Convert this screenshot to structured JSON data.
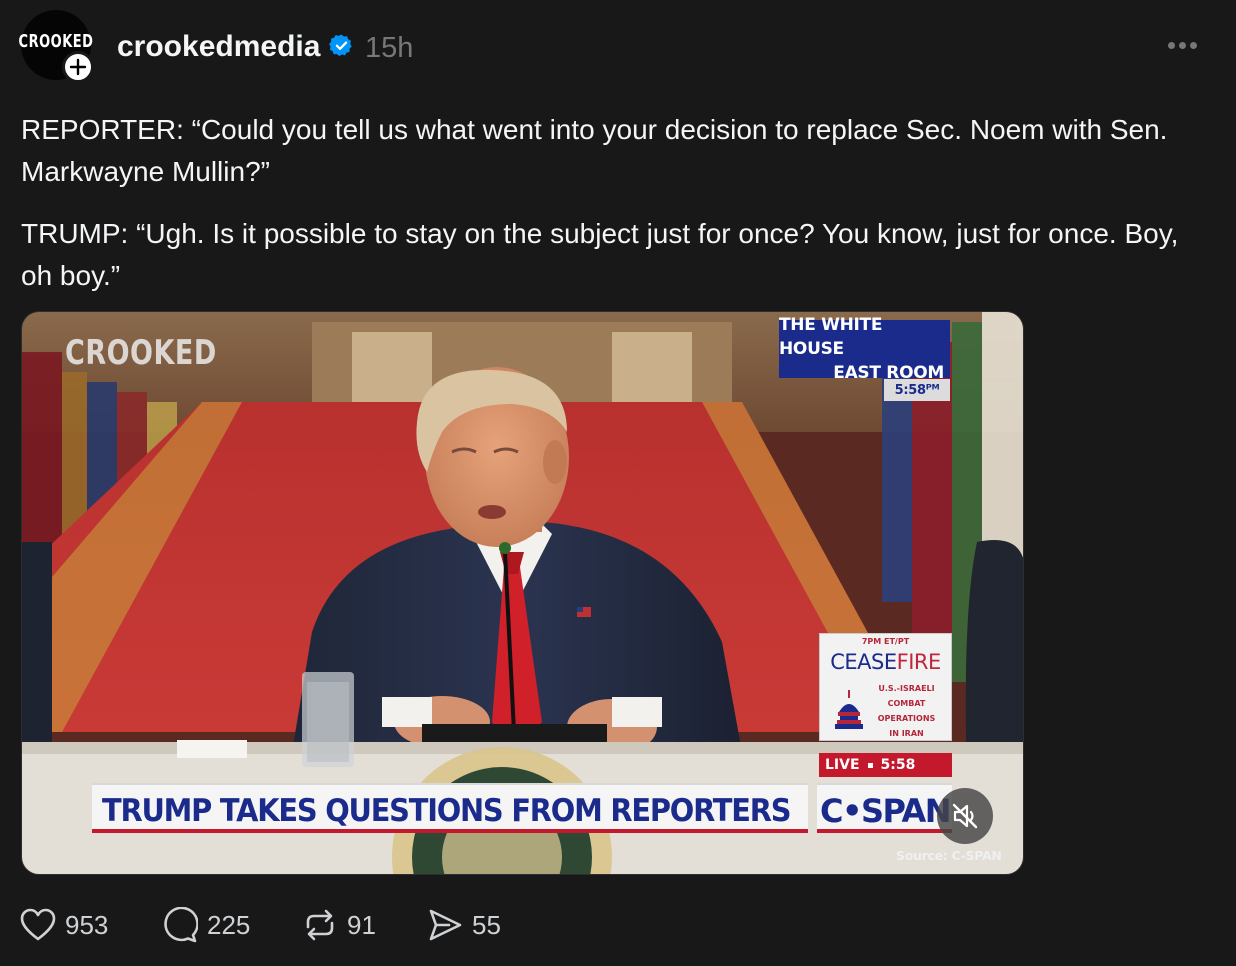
{
  "post": {
    "avatar_text": "CROOKED",
    "username": "crookedmedia",
    "verified": true,
    "timestamp": "15h",
    "paragraphs": [
      "REPORTER: “Could you tell us what went into your decision to replace Sec. Noem with Sen. Markwayne Mullin?”",
      "TRUMP: “Ugh. Is it possible to stay on the subject just for once? You know, just for once. Boy, oh boy.”"
    ]
  },
  "video": {
    "watermark": "CROOKED",
    "location_line1": "THE WHITE HOUSE",
    "location_line2": "EAST ROOM",
    "location_time": "5:58ᴾᴹ",
    "promo_time": "7PM ET/PT",
    "promo_word_a": "CEASE",
    "promo_word_b": "FIRE",
    "promo_sub": [
      "U.S.-ISRAELI",
      "COMBAT",
      "OPERATIONS",
      "IN IRAN"
    ],
    "live_label": "LIVE",
    "live_time": "5:58",
    "headline": "TRUMP TAKES QUESTIONS FROM REPORTERS",
    "network": "C•SPAN",
    "source": "Source: C-SPAN",
    "muted": true
  },
  "actions": {
    "likes": "953",
    "replies": "225",
    "reposts": "91",
    "shares": "55"
  },
  "colors": {
    "background": "#181818",
    "text": "#f3f5f7",
    "muted_text": "#777777",
    "verified": "#0095f6",
    "cspan_blue": "#1a2b8c",
    "cspan_red": "#c4192d"
  }
}
